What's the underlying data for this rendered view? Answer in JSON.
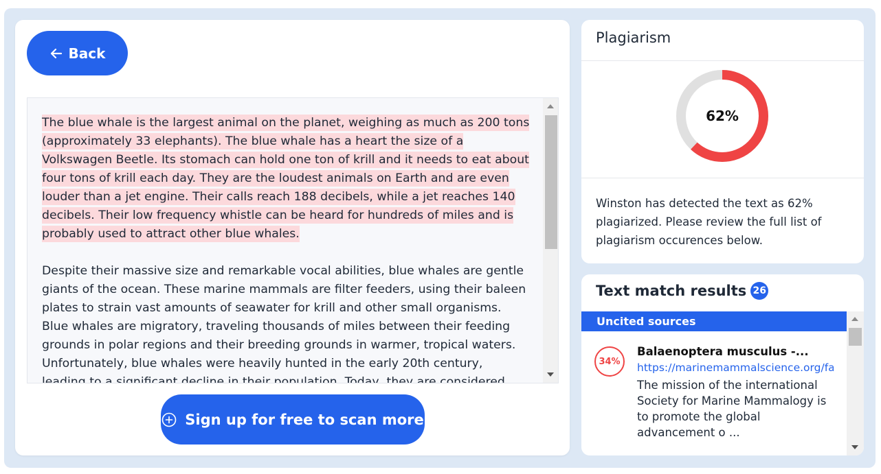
{
  "back_button": {
    "label": "Back"
  },
  "text": {
    "paragraph1": "The blue whale is the largest animal on the planet, weighing as much as 200 tons (approximately 33 elephants). The blue whale has a heart the size of a Volkswagen Beetle. Its stomach can hold one ton of krill and it needs to eat about four tons of krill each day. They are the loudest animals on Earth and are even louder than a jet engine. Their calls reach 188 decibels, while a jet reaches 140 decibels. Their low frequency whistle can be heard for hundreds of miles and is probably used to attract other blue whales.",
    "paragraph2": "Despite their massive size and remarkable vocal abilities, blue whales are gentle giants of the ocean. These marine mammals are filter feeders, using their baleen plates to strain vast amounts of seawater for krill and other small organisms. Blue whales are migratory, traveling thousands of miles between their feeding grounds in polar regions and their breeding grounds in warmer, tropical waters. Unfortunately, blue whales were heavily hunted in the early 20th century, leading to a significant decline in their population. Today, they are considered endangered",
    "highlight_color": "#fcd9dc"
  },
  "signup_button": {
    "label": "Sign up for free to scan more"
  },
  "plagiarism": {
    "title": "Plagiarism",
    "percent": 62,
    "percent_label": "62%",
    "description": "Winston has detected the text as 62% plagiarized. Please review the full list of plagiarism occurences below.",
    "ring_color": "#ef4444",
    "track_color": "#e0e0e0"
  },
  "matches": {
    "title": "Text match results",
    "count": "26",
    "section_label": "Uncited sources",
    "items": [
      {
        "percent": "34%",
        "title": "Balaenoptera musculus -...",
        "url": "https://marinemammalscience.org/fa",
        "snippet": "The mission of the international Society for Marine Mammalogy is to promote the global advancement o ..."
      }
    ]
  },
  "colors": {
    "accent": "#2563eb",
    "danger": "#ef4444",
    "background": "#dde8f5"
  }
}
